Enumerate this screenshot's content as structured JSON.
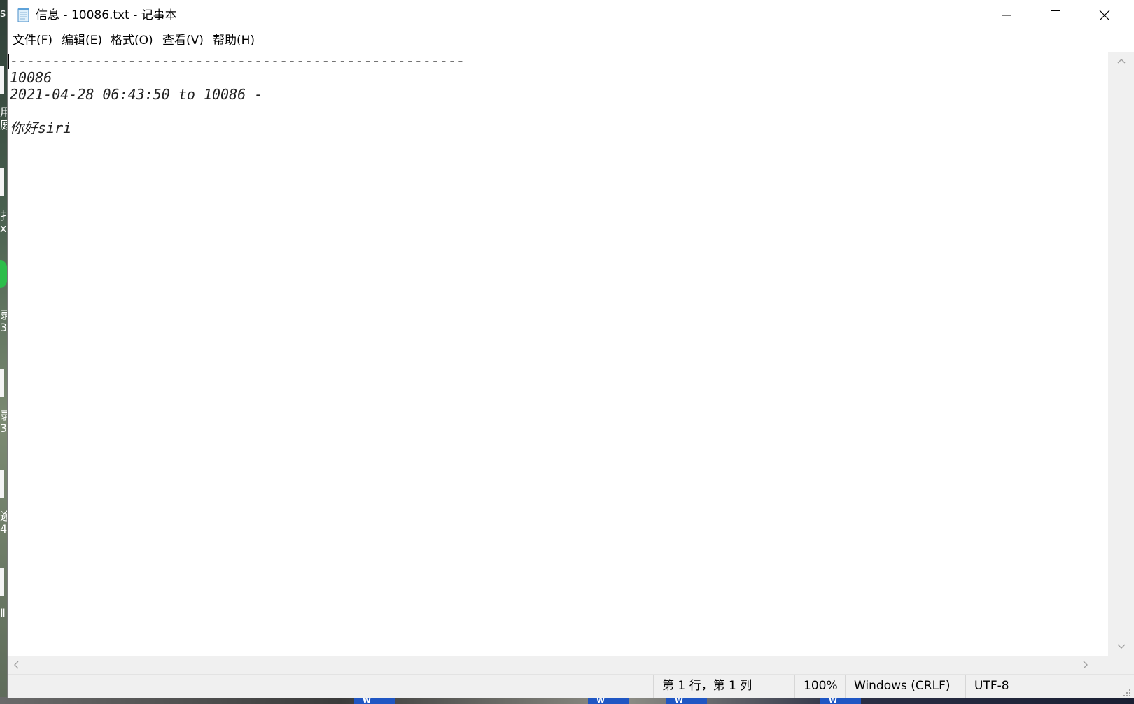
{
  "window": {
    "title": "信息 - 10086.txt - 记事本"
  },
  "menu": {
    "file": "文件(F)",
    "edit": "编辑(E)",
    "format": "格式(O)",
    "view": "查看(V)",
    "help": "帮助(H)"
  },
  "editor": {
    "content": "------------------------------------------------------\n10086\n2021-04-28 06:43:50 to 10086 -\n\n你好siri"
  },
  "status": {
    "position": "第 1 行，第 1 列",
    "zoom": "100%",
    "line_ending": "Windows (CRLF)",
    "encoding": "UTF-8"
  },
  "icons": {
    "app": "notepad-icon",
    "minimize": "minimize-icon",
    "maximize": "maximize-icon",
    "close": "close-icon"
  },
  "colors": {
    "window_bg": "#ffffff",
    "chrome_bg": "#f0f0f0",
    "text": "#000000"
  }
}
